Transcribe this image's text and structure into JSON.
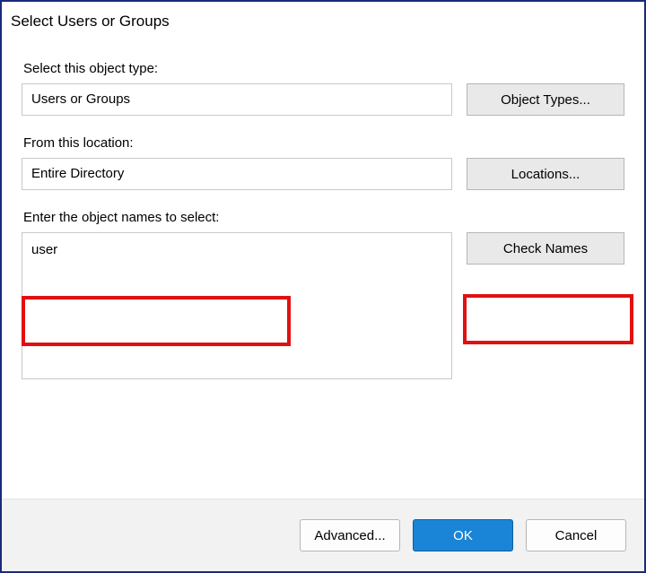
{
  "window": {
    "title": "Select Users or Groups"
  },
  "objectType": {
    "label": "Select this object type:",
    "value": "Users or Groups",
    "button": "Object Types..."
  },
  "location": {
    "label": "From this location:",
    "value": "Entire Directory",
    "button": "Locations..."
  },
  "objectNames": {
    "label": "Enter the object names to select:",
    "value": "user",
    "button": "Check Names"
  },
  "footer": {
    "advanced": "Advanced...",
    "ok": "OK",
    "cancel": "Cancel"
  }
}
